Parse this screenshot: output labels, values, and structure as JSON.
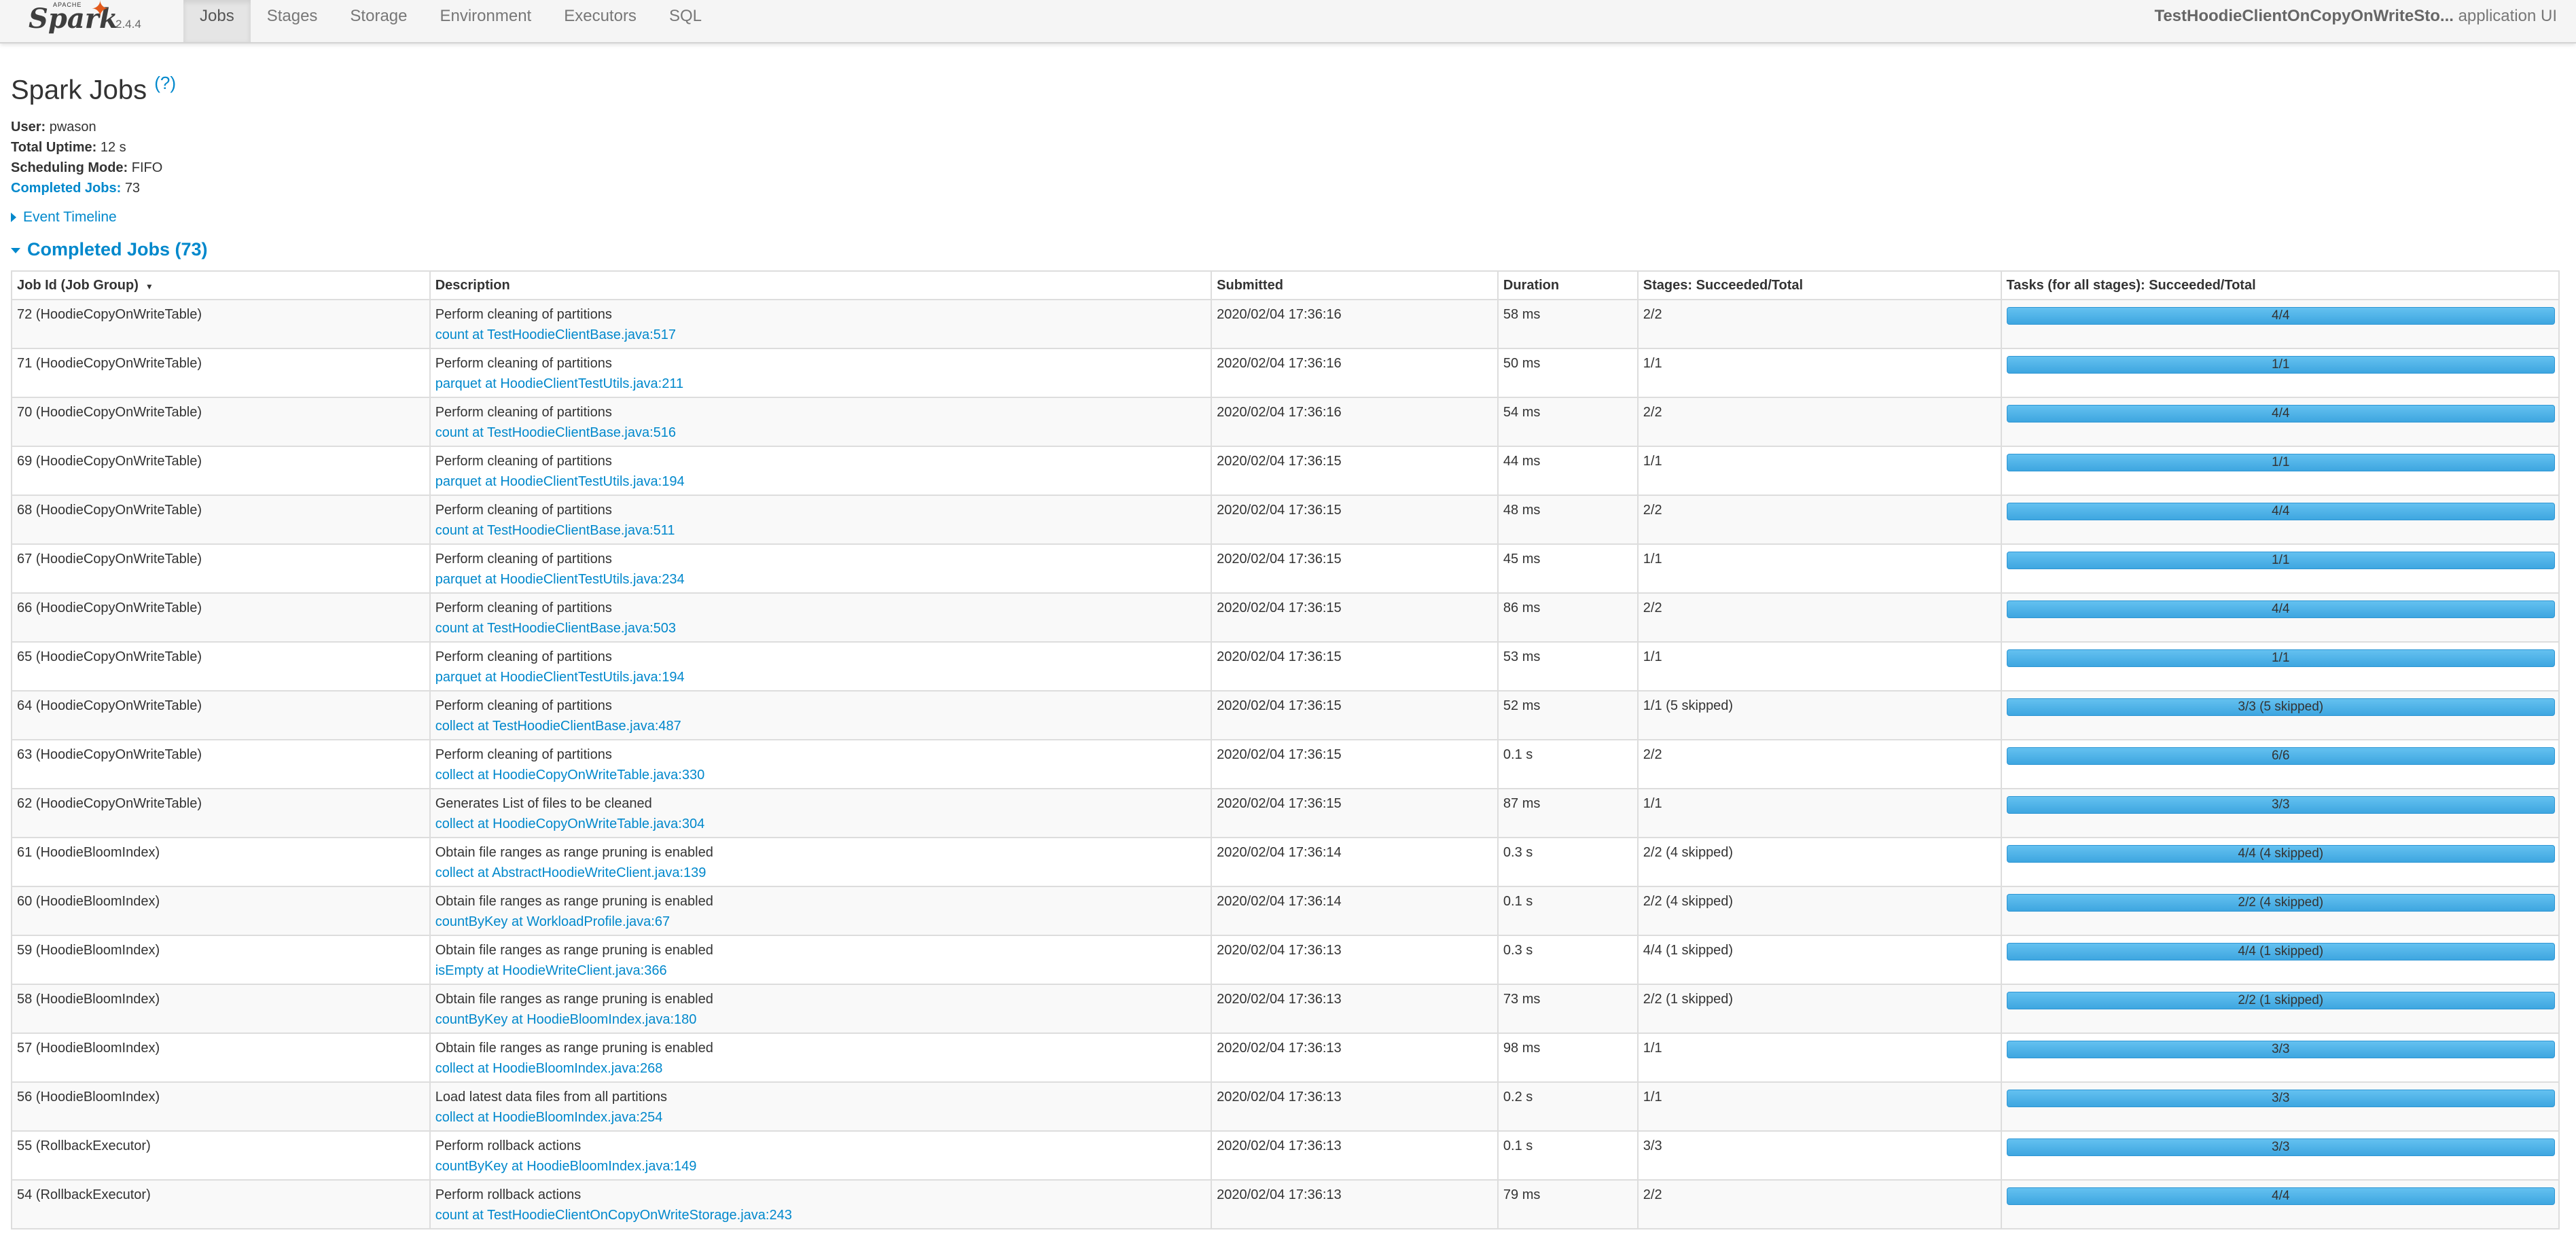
{
  "nav": {
    "logo_apache": "APACHE",
    "logo_spark": "Spark",
    "version": "2.4.4",
    "tabs": [
      "Jobs",
      "Stages",
      "Storage",
      "Environment",
      "Executors",
      "SQL"
    ],
    "app_name": "TestHoodieClientOnCopyOnWriteSto...",
    "app_suffix": " application UI"
  },
  "page": {
    "title": "Spark Jobs ",
    "help": "(?)",
    "user_label": "User:",
    "user": "pwason",
    "uptime_label": "Total Uptime:",
    "uptime": "12 s",
    "sched_label": "Scheduling Mode:",
    "sched": "FIFO",
    "completed_label": "Completed Jobs:",
    "completed": "73",
    "event_timeline": "Event Timeline",
    "completed_header": "Completed Jobs (73)"
  },
  "table": {
    "headers": [
      "Job Id (Job Group)",
      "Description",
      "Submitted",
      "Duration",
      "Stages: Succeeded/Total",
      "Tasks (for all stages): Succeeded/Total"
    ],
    "rows": [
      {
        "id": "72 (HoodieCopyOnWriteTable)",
        "desc": "Perform cleaning of partitions",
        "link": "count at TestHoodieClientBase.java:517",
        "submitted": "2020/02/04 17:36:16",
        "duration": "58 ms",
        "stages": "2/2",
        "tasks": "4/4",
        "progress": 1.0
      },
      {
        "id": "71 (HoodieCopyOnWriteTable)",
        "desc": "Perform cleaning of partitions",
        "link": "parquet at HoodieClientTestUtils.java:211",
        "submitted": "2020/02/04 17:36:16",
        "duration": "50 ms",
        "stages": "1/1",
        "tasks": "1/1",
        "progress": 1.0
      },
      {
        "id": "70 (HoodieCopyOnWriteTable)",
        "desc": "Perform cleaning of partitions",
        "link": "count at TestHoodieClientBase.java:516",
        "submitted": "2020/02/04 17:36:16",
        "duration": "54 ms",
        "stages": "2/2",
        "tasks": "4/4",
        "progress": 1.0
      },
      {
        "id": "69 (HoodieCopyOnWriteTable)",
        "desc": "Perform cleaning of partitions",
        "link": "parquet at HoodieClientTestUtils.java:194",
        "submitted": "2020/02/04 17:36:15",
        "duration": "44 ms",
        "stages": "1/1",
        "tasks": "1/1",
        "progress": 1.0
      },
      {
        "id": "68 (HoodieCopyOnWriteTable)",
        "desc": "Perform cleaning of partitions",
        "link": "count at TestHoodieClientBase.java:511",
        "submitted": "2020/02/04 17:36:15",
        "duration": "48 ms",
        "stages": "2/2",
        "tasks": "4/4",
        "progress": 1.0
      },
      {
        "id": "67 (HoodieCopyOnWriteTable)",
        "desc": "Perform cleaning of partitions",
        "link": "parquet at HoodieClientTestUtils.java:234",
        "submitted": "2020/02/04 17:36:15",
        "duration": "45 ms",
        "stages": "1/1",
        "tasks": "1/1",
        "progress": 1.0
      },
      {
        "id": "66 (HoodieCopyOnWriteTable)",
        "desc": "Perform cleaning of partitions",
        "link": "count at TestHoodieClientBase.java:503",
        "submitted": "2020/02/04 17:36:15",
        "duration": "86 ms",
        "stages": "2/2",
        "tasks": "4/4",
        "progress": 1.0
      },
      {
        "id": "65 (HoodieCopyOnWriteTable)",
        "desc": "Perform cleaning of partitions",
        "link": "parquet at HoodieClientTestUtils.java:194",
        "submitted": "2020/02/04 17:36:15",
        "duration": "53 ms",
        "stages": "1/1",
        "tasks": "1/1",
        "progress": 1.0
      },
      {
        "id": "64 (HoodieCopyOnWriteTable)",
        "desc": "Perform cleaning of partitions",
        "link": "collect at TestHoodieClientBase.java:487",
        "submitted": "2020/02/04 17:36:15",
        "duration": "52 ms",
        "stages": "1/1 (5 skipped)",
        "tasks": "3/3 (5 skipped)",
        "progress": 1.0
      },
      {
        "id": "63 (HoodieCopyOnWriteTable)",
        "desc": "Perform cleaning of partitions",
        "link": "collect at HoodieCopyOnWriteTable.java:330",
        "submitted": "2020/02/04 17:36:15",
        "duration": "0.1 s",
        "stages": "2/2",
        "tasks": "6/6",
        "progress": 1.0
      },
      {
        "id": "62 (HoodieCopyOnWriteTable)",
        "desc": "Generates List of files to be cleaned",
        "link": "collect at HoodieCopyOnWriteTable.java:304",
        "submitted": "2020/02/04 17:36:15",
        "duration": "87 ms",
        "stages": "1/1",
        "tasks": "3/3",
        "progress": 1.0
      },
      {
        "id": "61 (HoodieBloomIndex)",
        "desc": "Obtain file ranges as range pruning is enabled",
        "link": "collect at AbstractHoodieWriteClient.java:139",
        "submitted": "2020/02/04 17:36:14",
        "duration": "0.3 s",
        "stages": "2/2 (4 skipped)",
        "tasks": "4/4 (4 skipped)",
        "progress": 1.0
      },
      {
        "id": "60 (HoodieBloomIndex)",
        "desc": "Obtain file ranges as range pruning is enabled",
        "link": "countByKey at WorkloadProfile.java:67",
        "submitted": "2020/02/04 17:36:14",
        "duration": "0.1 s",
        "stages": "2/2 (4 skipped)",
        "tasks": "2/2 (4 skipped)",
        "progress": 1.0
      },
      {
        "id": "59 (HoodieBloomIndex)",
        "desc": "Obtain file ranges as range pruning is enabled",
        "link": "isEmpty at HoodieWriteClient.java:366",
        "submitted": "2020/02/04 17:36:13",
        "duration": "0.3 s",
        "stages": "4/4 (1 skipped)",
        "tasks": "4/4 (1 skipped)",
        "progress": 1.0
      },
      {
        "id": "58 (HoodieBloomIndex)",
        "desc": "Obtain file ranges as range pruning is enabled",
        "link": "countByKey at HoodieBloomIndex.java:180",
        "submitted": "2020/02/04 17:36:13",
        "duration": "73 ms",
        "stages": "2/2 (1 skipped)",
        "tasks": "2/2 (1 skipped)",
        "progress": 1.0
      },
      {
        "id": "57 (HoodieBloomIndex)",
        "desc": "Obtain file ranges as range pruning is enabled",
        "link": "collect at HoodieBloomIndex.java:268",
        "submitted": "2020/02/04 17:36:13",
        "duration": "98 ms",
        "stages": "1/1",
        "tasks": "3/3",
        "progress": 1.0
      },
      {
        "id": "56 (HoodieBloomIndex)",
        "desc": "Load latest data files from all partitions",
        "link": "collect at HoodieBloomIndex.java:254",
        "submitted": "2020/02/04 17:36:13",
        "duration": "0.2 s",
        "stages": "1/1",
        "tasks": "3/3",
        "progress": 1.0
      },
      {
        "id": "55 (RollbackExecutor)",
        "desc": "Perform rollback actions",
        "link": "countByKey at HoodieBloomIndex.java:149",
        "submitted": "2020/02/04 17:36:13",
        "duration": "0.1 s",
        "stages": "3/3",
        "tasks": "3/3",
        "progress": 1.0
      },
      {
        "id": "54 (RollbackExecutor)",
        "desc": "Perform rollback actions",
        "link": "count at TestHoodieClientOnCopyOnWriteStorage.java:243",
        "submitted": "2020/02/04 17:36:13",
        "duration": "79 ms",
        "stages": "2/2",
        "tasks": "4/4",
        "progress": 1.0
      }
    ]
  },
  "colors": {
    "link": "#0088cc",
    "bar": "#3ea6e0",
    "spark_star": "#e25a1c"
  },
  "icons": {
    "logo": "spark-logo",
    "help": "help-link",
    "expand": "triangle-right-icon",
    "collapse": "triangle-down-icon",
    "sort": "sort-desc-icon"
  }
}
